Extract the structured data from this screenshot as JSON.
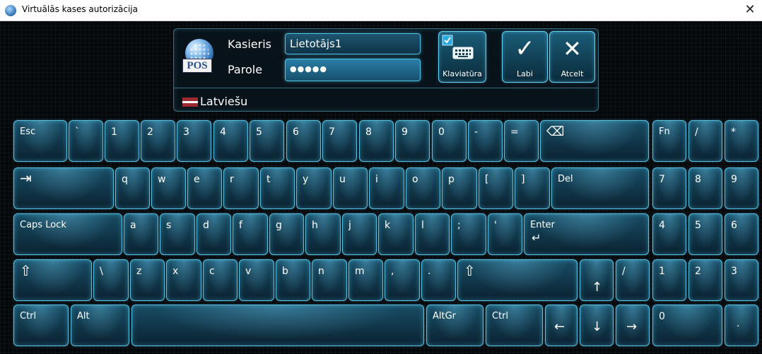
{
  "window": {
    "title": "Virtuālās kases autorizācija",
    "close_glyph": "✕"
  },
  "login": {
    "cashier_label": "Kasieris",
    "cashier_value": "Lietotājs1",
    "password_label": "Parole",
    "password_value": "●●●●●",
    "logo_text": "POS"
  },
  "buttons": {
    "keyboard_label": "Klaviatūra",
    "ok_label": "Labi",
    "cancel_label": "Atcelt",
    "ok_glyph": "✓",
    "cancel_glyph": "✕"
  },
  "language": {
    "label": "Latviešu"
  },
  "keys": {
    "esc": "Esc",
    "backtick": "`",
    "k1": "1",
    "k2": "2",
    "k3": "3",
    "k4": "4",
    "k5": "5",
    "k6": "6",
    "k7": "7",
    "k8": "8",
    "k9": "9",
    "k0": "0",
    "minus": "-",
    "equals": "=",
    "backspace": "⌫",
    "fn": "Fn",
    "np_slash": "/",
    "np_star": "*",
    "tab": "⇥",
    "q": "q",
    "w": "w",
    "e": "e",
    "r": "r",
    "t": "t",
    "y": "y",
    "u": "u",
    "i": "i",
    "o": "o",
    "p": "p",
    "lbracket": "[",
    "rbracket": "]",
    "del": "Del",
    "np7": "7",
    "np8": "8",
    "np9": "9",
    "caps": "Caps Lock",
    "a": "a",
    "s": "s",
    "d": "d",
    "f": "f",
    "g": "g",
    "h": "h",
    "j": "j",
    "k": "k",
    "l": "l",
    "semicolon": ";",
    "quote": "'",
    "enter": "Enter",
    "enter_glyph": "↵",
    "np4": "4",
    "np5": "5",
    "np6": "6",
    "shift_glyph": "⇧",
    "backslash": "\\",
    "z": "z",
    "x": "x",
    "c": "c",
    "v": "v",
    "b": "b",
    "n": "n",
    "m": "m",
    "comma": ",",
    "period": ".",
    "up": "↑",
    "slash": "/",
    "np1": "1",
    "np2": "2",
    "np3": "3",
    "ctrl": "Ctrl",
    "alt": "Alt",
    "altgr": "AltGr",
    "left": "←",
    "down": "↓",
    "right": "→",
    "np0": "0",
    "np_dot": "."
  }
}
